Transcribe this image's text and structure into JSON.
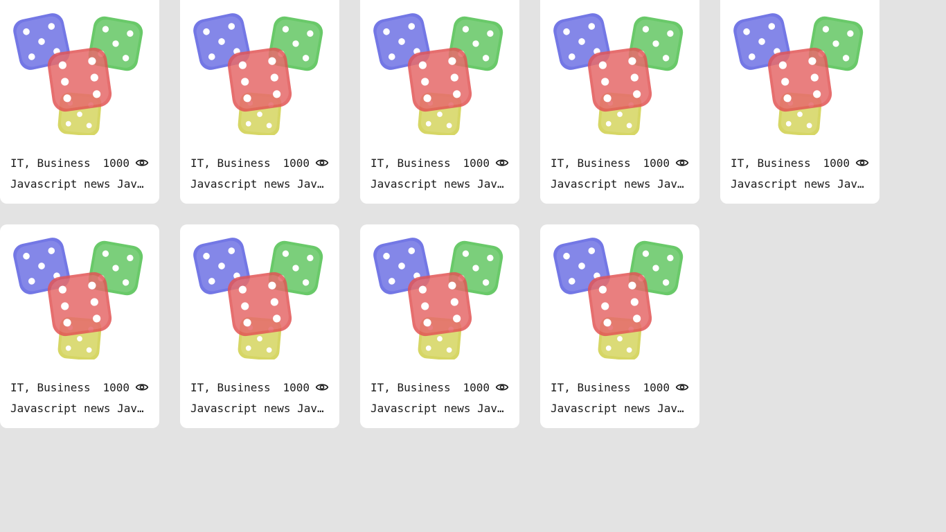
{
  "colors": {
    "background": "#e3e3e3",
    "card": "#ffffff",
    "text": "#1a1a1a",
    "die_blue": "#5a5fe0",
    "die_green": "#4fbf4f",
    "die_red": "#e25555",
    "die_yellow": "#cfcf4a"
  },
  "cards": [
    {
      "category": "IT, Business",
      "views": "1000",
      "title": "Javascript news Javascript news",
      "image_icon": "dice-image",
      "view_icon": "eye-icon"
    },
    {
      "category": "IT, Business",
      "views": "1000",
      "title": "Javascript news Javascript news",
      "image_icon": "dice-image",
      "view_icon": "eye-icon"
    },
    {
      "category": "IT, Business",
      "views": "1000",
      "title": "Javascript news Javascript news",
      "image_icon": "dice-image",
      "view_icon": "eye-icon"
    },
    {
      "category": "IT, Business",
      "views": "1000",
      "title": "Javascript news Javascript news",
      "image_icon": "dice-image",
      "view_icon": "eye-icon"
    },
    {
      "category": "IT, Business",
      "views": "1000",
      "title": "Javascript news Javascript news",
      "image_icon": "dice-image",
      "view_icon": "eye-icon"
    },
    {
      "category": "IT, Business",
      "views": "1000",
      "title": "Javascript news Javascript news",
      "image_icon": "dice-image",
      "view_icon": "eye-icon"
    },
    {
      "category": "IT, Business",
      "views": "1000",
      "title": "Javascript news Javascript news",
      "image_icon": "dice-image",
      "view_icon": "eye-icon"
    },
    {
      "category": "IT, Business",
      "views": "1000",
      "title": "Javascript news Javascript news",
      "image_icon": "dice-image",
      "view_icon": "eye-icon"
    },
    {
      "category": "IT, Business",
      "views": "1000",
      "title": "Javascript news Javascript news",
      "image_icon": "dice-image",
      "view_icon": "eye-icon"
    }
  ]
}
